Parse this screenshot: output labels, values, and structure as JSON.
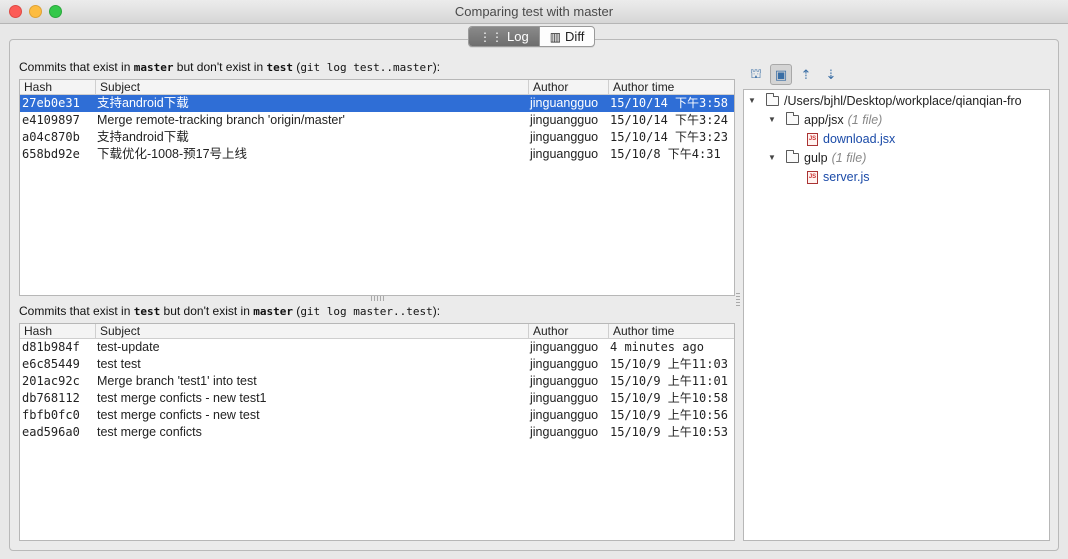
{
  "window": {
    "title": "Comparing test with master"
  },
  "tabs": [
    {
      "label": "Log",
      "icon": "log-icon",
      "active": true
    },
    {
      "label": "Diff",
      "icon": "diff-icon",
      "active": false
    }
  ],
  "top": {
    "caption": {
      "p1": "Commits that exist in ",
      "b1": "master",
      "p2": " but don't exist in ",
      "b2": "test",
      "p3": " (",
      "cmd": "git log test..master",
      "p4": "):"
    },
    "columns": [
      "Hash",
      "Subject",
      "Author",
      "Author time"
    ],
    "rows": [
      {
        "hash": "27eb0e31",
        "subject": "支持android下载",
        "author": "jinguangguo",
        "time": "15/10/14 下午3:58",
        "selected": true
      },
      {
        "hash": "e4109897",
        "subject": "Merge remote-tracking branch 'origin/master'",
        "author": "jinguangguo",
        "time": "15/10/14 下午3:24"
      },
      {
        "hash": "a04c870b",
        "subject": "支持android下载",
        "author": "jinguangguo",
        "time": "15/10/14 下午3:23"
      },
      {
        "hash": "658bd92e",
        "subject": "下载优化-1008-预17号上线",
        "author": "jinguangguo",
        "time": "15/10/8 下午4:31"
      }
    ]
  },
  "bottom": {
    "caption": {
      "p1": "Commits that exist in ",
      "b1": "test",
      "p2": " but don't exist in ",
      "b2": "master",
      "p3": " (",
      "cmd": "git log master..test",
      "p4": "):"
    },
    "columns": [
      "Hash",
      "Subject",
      "Author",
      "Author time"
    ],
    "rows": [
      {
        "hash": "d81b984f",
        "subject": "test-update",
        "author": "jinguangguo",
        "time": "4 minutes ago"
      },
      {
        "hash": "e6c85449",
        "subject": "test test",
        "author": "jinguangguo",
        "time": "15/10/9 上午11:03"
      },
      {
        "hash": "201ac92c",
        "subject": "Merge branch 'test1' into test",
        "author": "jinguangguo",
        "time": "15/10/9 上午11:01"
      },
      {
        "hash": "db768112",
        "subject": "test merge conficts - new test1",
        "author": "jinguangguo",
        "time": "15/10/9 上午10:58"
      },
      {
        "hash": "fbfb0fc0",
        "subject": "test merge conficts - new test",
        "author": "jinguangguo",
        "time": "15/10/9 上午10:56"
      },
      {
        "hash": "ead596a0",
        "subject": "test merge conficts",
        "author": "jinguangguo",
        "time": "15/10/9 上午10:53"
      }
    ]
  },
  "toolbar": {
    "buttons": [
      {
        "icon": "group-by-module-icon",
        "pressed": false
      },
      {
        "icon": "group-by-directory-icon",
        "pressed": true
      },
      {
        "icon": "expand-all-icon",
        "pressed": false
      },
      {
        "icon": "collapse-all-icon",
        "pressed": false
      }
    ]
  },
  "tree": {
    "root": "/Users/bjhl/Desktop/workplace/qianqian-fro",
    "nodes": [
      {
        "label": "app/jsx",
        "count": "(1 file)",
        "children": [
          "download.jsx"
        ]
      },
      {
        "label": "gulp",
        "count": "(1 file)",
        "children": [
          "server.js"
        ]
      }
    ]
  }
}
